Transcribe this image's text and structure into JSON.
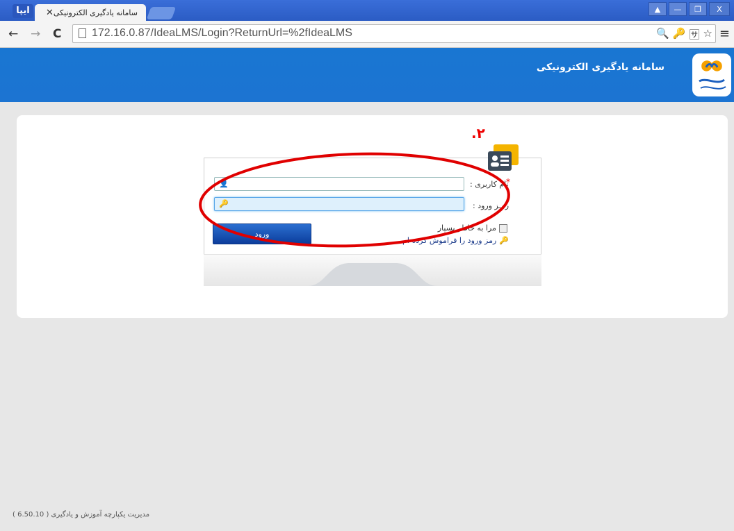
{
  "browser": {
    "app_badge": "ایپا",
    "tab_title": "سامانه یادگیری الکترونیکی",
    "tab_close": "✕",
    "window_controls": [
      "▲",
      "—",
      "❐",
      "X"
    ],
    "url": "172.16.0.87/IdeaLMS/Login?ReturnUrl=%2fIdeaLMS",
    "nav": {
      "back": "←",
      "forward": "→",
      "reload": "C"
    },
    "omni_icons": [
      "🔍",
      "🔑",
      "🈂",
      "☆"
    ],
    "menu": "≡"
  },
  "header": {
    "title": "سامانه یادگیری الکترونیکی"
  },
  "login": {
    "annotation": ".۲",
    "required_mark": "*",
    "username_label": "نام کاربری :",
    "password_label": "رمـز ورود :",
    "username_icon": "👤",
    "password_icon": "🔑",
    "submit_label": "ورود",
    "remember_label": "مرا به خاطر بسپار",
    "forgot_label": "رمز ورود را فراموش کرده ام",
    "forgot_icon": "🔑"
  },
  "footer": {
    "text": "مدیریت یکپارچه آموزش و یادگیری ( 6.50.10 )"
  },
  "colors": {
    "header_bg": "#1976d2",
    "annotation_red": "#e00000",
    "button_blue": "#0c3d9c"
  }
}
